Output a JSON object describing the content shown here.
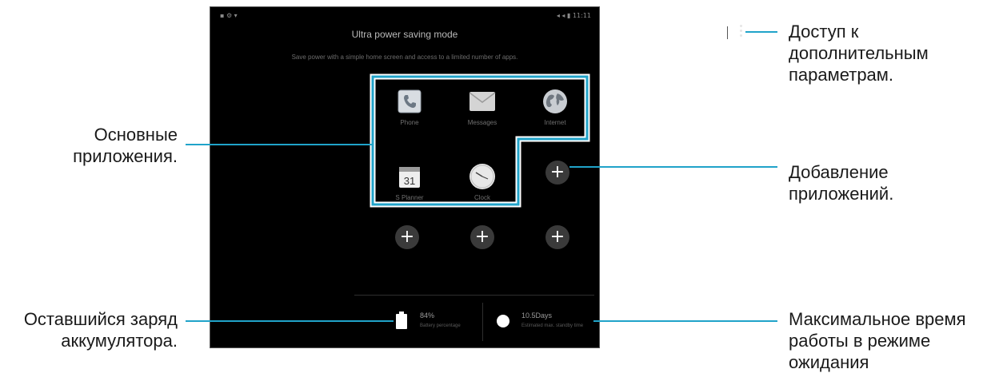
{
  "device": {
    "status_left": "▪ ⚙ ▾",
    "status_right": "◂ ◂ ▮ 11:11",
    "title": "Ultra power saving mode",
    "subtitle": "Save power with a simple home screen and access to a limited number of apps.",
    "apps": [
      {
        "label": "Phone",
        "icon": "phone-icon"
      },
      {
        "label": "Messages",
        "icon": "envelope-icon"
      },
      {
        "label": "Internet",
        "icon": "globe-icon"
      },
      {
        "label": "S Planner",
        "icon": "calendar-icon",
        "glyph": "31"
      },
      {
        "label": "Clock",
        "icon": "clock-icon"
      }
    ],
    "add_symbol": "+",
    "battery": {
      "value": "84%",
      "caption": "Battery percentage"
    },
    "standby": {
      "value": "10.5Days",
      "caption": "Estimated max. standby time"
    }
  },
  "annotations": {
    "more_options": "Доступ к\nдополнительным\nпараметрам.",
    "core_apps": "Основные\nприложения.",
    "add_apps": "Добавление\nприложений.",
    "battery_left": "Оставшийся заряд\nаккумулятора.",
    "standby_time": "Максимальное время\nработы в режиме\nожидания"
  },
  "colors": {
    "highlight": "#20a3c9",
    "screen": "#000000"
  }
}
